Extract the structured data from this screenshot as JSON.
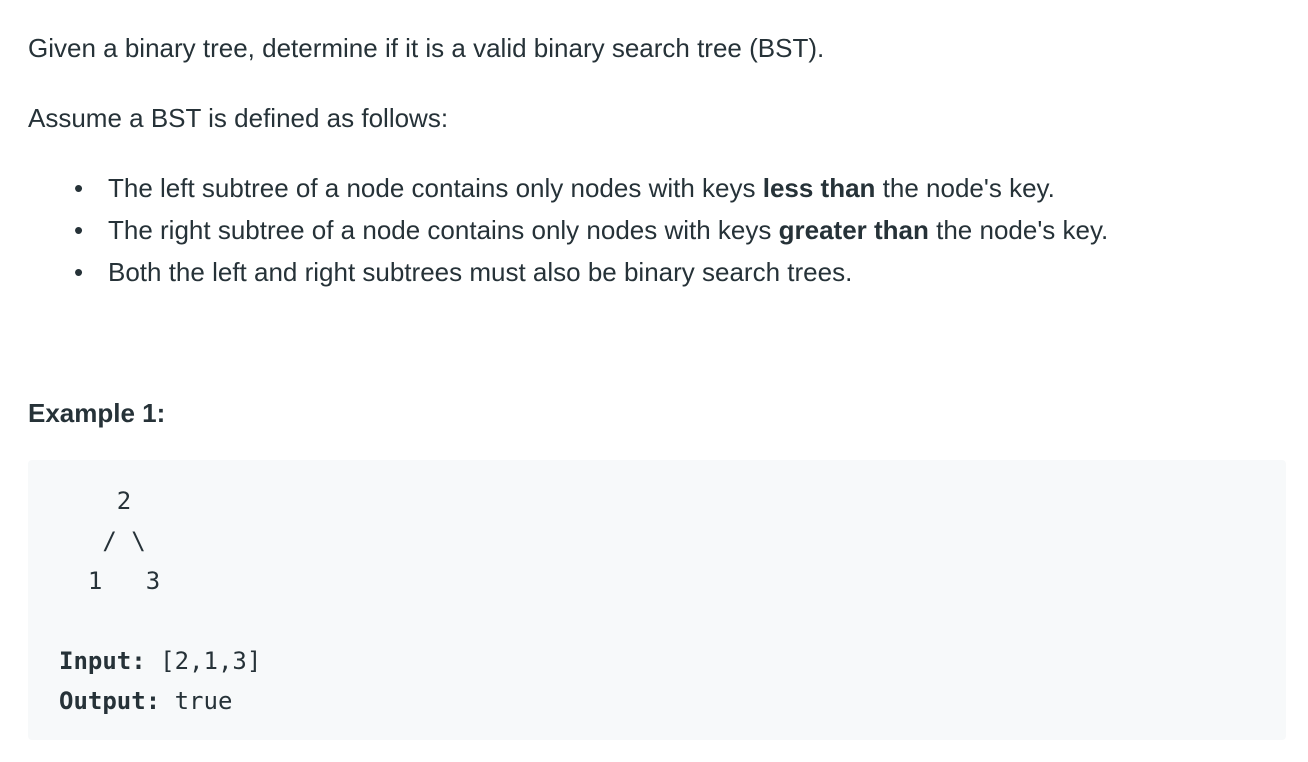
{
  "intro": "Given a binary tree, determine if it is a valid binary search tree (BST).",
  "assume": "Assume a BST is defined as follows:",
  "rules": [
    {
      "bullet": "•",
      "before": "The left subtree of a node contains only nodes with keys ",
      "bold": "less than",
      "after": " the node's key."
    },
    {
      "bullet": "•",
      "before": "The right subtree of a node contains only nodes with keys ",
      "bold": "greater than",
      "after": " the node's key."
    },
    {
      "bullet": "•",
      "before": "Both the left and right subtrees must also be binary search trees.",
      "bold": "",
      "after": ""
    }
  ],
  "example": {
    "heading": "Example 1:",
    "tree_lines": [
      "    2",
      "   / \\",
      "  1   3"
    ],
    "input_label": "Input:",
    "input_value": " [2,1,3]",
    "output_label": "Output:",
    "output_value": " true"
  }
}
